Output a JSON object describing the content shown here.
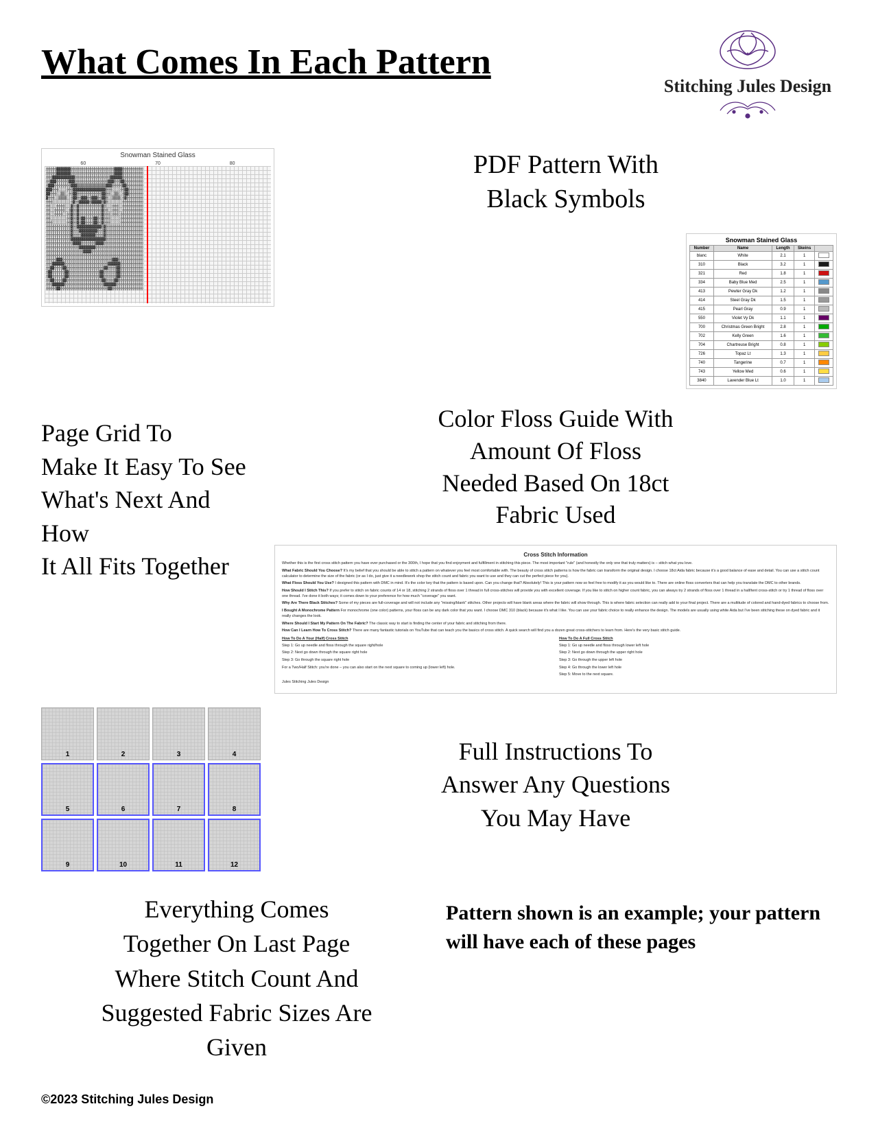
{
  "header": {
    "title": "What Comes In Each Pattern",
    "logo": {
      "line1": "Stitching Jules Design",
      "flourish": "❧"
    }
  },
  "section1": {
    "pattern_title": "Snowman Stained Glass",
    "pdf_label": "PDF Pattern With\nBlack Symbols",
    "floss_guide": {
      "title": "Snowman Stained Glass",
      "columns": [
        "Number",
        "Name",
        "Length",
        "Skeins"
      ],
      "rows": [
        [
          "blanc",
          "White",
          "2.1",
          "1",
          "#FFFFFF"
        ],
        [
          "310",
          "Black",
          "3.2",
          "1",
          "#1a1a1a"
        ],
        [
          "321",
          "Red",
          "1.8",
          "1",
          "#cc1111"
        ],
        [
          "334",
          "Baby Blue Med",
          "2.5",
          "1",
          "#5599cc"
        ],
        [
          "413",
          "Pewter Gray Dk",
          "1.2",
          "1",
          "#888888"
        ],
        [
          "414",
          "Steel Gray Dk",
          "1.5",
          "1",
          "#999999"
        ],
        [
          "415",
          "Pearl Gray",
          "0.9",
          "1",
          "#bbbbbb"
        ],
        [
          "550",
          "Violet Vy Dk",
          "1.1",
          "1",
          "#660066"
        ],
        [
          "700",
          "Christmas Green Bright",
          "2.8",
          "1",
          "#00aa00"
        ],
        [
          "702",
          "Kelly Green",
          "1.6",
          "1",
          "#33bb33"
        ],
        [
          "704",
          "Chartreuse Bright",
          "0.8",
          "1",
          "#88cc00"
        ],
        [
          "726",
          "Topaz Lt",
          "1.3",
          "1",
          "#ffcc44"
        ],
        [
          "740",
          "Tangerine",
          "0.7",
          "1",
          "#ff8800"
        ],
        [
          "743",
          "Yellow Med",
          "0.6",
          "1",
          "#ffdd44"
        ],
        [
          "3840",
          "Lavender Blue Lt",
          "1.0",
          "1",
          "#aaccee"
        ]
      ]
    }
  },
  "section2": {
    "page_grid_label": "Page Grid To\nMake It Easy To See\nWhat's Next And How\nIt All Fits Together",
    "floss_guide_label": "Color Floss Guide With\nAmount Of Floss\nNeeded Based On 18ct\nFabric Used",
    "info_doc": {
      "title": "Cross Stitch Information",
      "paragraphs": [
        {
          "subtitle": null,
          "text": "Whether this is the first cross stitch pattern you have ever purchased or the 300th, I hope that you find enjoyment and fulfillment in stitching this piece. The most important \"rule\" (and honestly the only one that truly matters) is – stitch what you love."
        },
        {
          "subtitle": "What Fabric Should You Choose?",
          "text": "It's my belief that you should be able to stitch a pattern on whatever you feel most comfortable with. The beauty of cross stitch patterns is how the fabric can transform the original design. I choose 18ct Aida fabric because it's a good balance of ease and detail. You can use a stitch count calculator to determine the size of the fabric (or as I do, just give it a needlework shop the stitch count and fabric you want to use and they can cut the perfect piece for you)."
        },
        {
          "subtitle": "What Floss Should You Use?",
          "text": "I designed this pattern with DMC in mind. It's the color key that the pattern is based upon. Can you change that? Absolutely! This is your pattern now so feel free to modify it as you would like to. There are online floss converters that can help you translate the DMC to other brands."
        },
        {
          "subtitle": "How Should I Stitch This?",
          "text": "If you prefer to stitch on fabric counts of 14 or 18, stitching 2 strands of floss over 1 thread in full cross-stitches will provide you with excellent coverage. If you like to stitch on higher count fabric, you can always try 2 strands of floss over 1 thread in a half/tent cross-stitch or try 1 thread of floss over one thread. I've done it both ways; it comes down to your preference for how much \"coverage\" you want."
        },
        {
          "subtitle": "Why Are There Black Stitches?",
          "text": "Some of my pieces are full-coverage and will not include any \"missing/blank\" stitches. Other projects will have blank areas where the fabric will show through. This is where fabric selection can really add to your final project. There are a multitude of colored and hand-dyed fabrics to choose from."
        },
        {
          "subtitle": "I Bought A Monochrome Pattern",
          "text": "For monochrome (one color) patterns, your floss can be any dark color that you want. I choose DMC 310 (black) because it's what I like. You can use your fabric choice to really enhance the design. The models are usually using white Aida but I've been stitching these on dyed fabric and it really changes the look."
        },
        {
          "subtitle": "Where Should I Start My Pattern On The Fabric?",
          "text": "The classic way to start is finding the center of your fabric and stitching from there."
        },
        {
          "subtitle": "How Can I Learn How To Cross Stitch?",
          "text": "There are many fantastic tutorials on YouTube that can teach you the basics of cross stitch. A quick search will find you a dozen great cross-stitchers to learn from. Here's the very basic stitch guide."
        },
        {
          "two_col": true,
          "col1_title": "How To Do A Your (Half) Cross Stitch",
          "col1_steps": [
            "Step 1: Go up needle and floss through the square right/hole",
            "Step 2: Next go down through the square right hole",
            "Step 3: Go through the square right hole",
            "For a Two/Half Stitch: you're done – you can also start on the next square to coming up (lower left) hole."
          ],
          "col2_title": "How To Do A Full Cross Stitch",
          "col2_steps": [
            "Step 1: Go up needle and floss through lower left hole",
            "Step 2: Next go down through the upper right hole",
            "Step 3: Go through the upper left hole",
            "Step 4: Go through the lower left hole",
            "Step 5: Move to the next square."
          ]
        },
        {
          "subtitle": null,
          "text": "Jules\nStitching Jules Design"
        }
      ]
    }
  },
  "section3": {
    "thumbnails": {
      "count": 12,
      "highlighted": [
        5,
        6,
        7,
        8,
        9,
        10,
        11,
        12
      ],
      "labels": [
        "1",
        "2",
        "3",
        "4",
        "5",
        "6",
        "7",
        "8",
        "9",
        "10",
        "11",
        "12"
      ]
    },
    "full_instructions_label": "Full Instructions To\nAnswer Any Questions\nYou May Have"
  },
  "section4": {
    "stitch_count_label": "Everything Comes\nTogether On Last Page\nWhere Stitch Count And\nSuggested Fabric Sizes Are\nGiven",
    "pattern_note_label": "Pattern shown is an example; your pattern will have each of these pages"
  },
  "footer": {
    "copyright": "©2023 Stitching Jules Design"
  }
}
